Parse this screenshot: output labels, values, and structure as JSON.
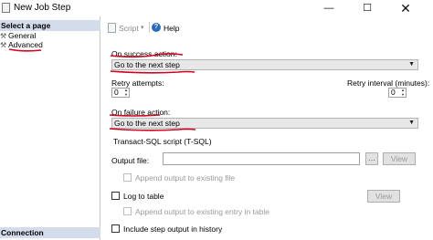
{
  "window": {
    "title": "New Job Step",
    "minimize_glyph": "—",
    "maximize_glyph": "☐",
    "close_glyph": "✕"
  },
  "sidebar": {
    "header": "Select a page",
    "items": [
      {
        "label": "General",
        "icon": "page-wrench-icon"
      },
      {
        "label": "Advanced",
        "icon": "page-wrench-icon"
      }
    ],
    "footer_header": "Connection"
  },
  "toolbar": {
    "script_label": "Script",
    "script_dropdown_glyph": "▾",
    "help_label": "Help",
    "help_glyph": "?"
  },
  "form": {
    "on_success_label": "On success action:",
    "on_success_value": "Go to the next step",
    "retry_attempts_label": "Retry attempts:",
    "retry_attempts_value": "0",
    "retry_interval_label": "Retry interval (minutes):",
    "retry_interval_value": "0",
    "on_failure_label": "On failure action:",
    "on_failure_value": "Go to the next step",
    "tsql_header": "Transact-SQL script (T-SQL)",
    "output_file_label": "Output file:",
    "output_file_value": "",
    "view_button_1": "View",
    "append_output_label": "Append output to existing file",
    "log_to_table_label": "Log to table",
    "view_button_2": "View",
    "append_entry_label": "Append output to existing entry in table",
    "include_history_label": "Include step output in history"
  },
  "colors": {
    "annotation_red": "#d0021b",
    "pane_header_bg": "#d3dcea",
    "combo_bg": "#e8e8e8"
  }
}
